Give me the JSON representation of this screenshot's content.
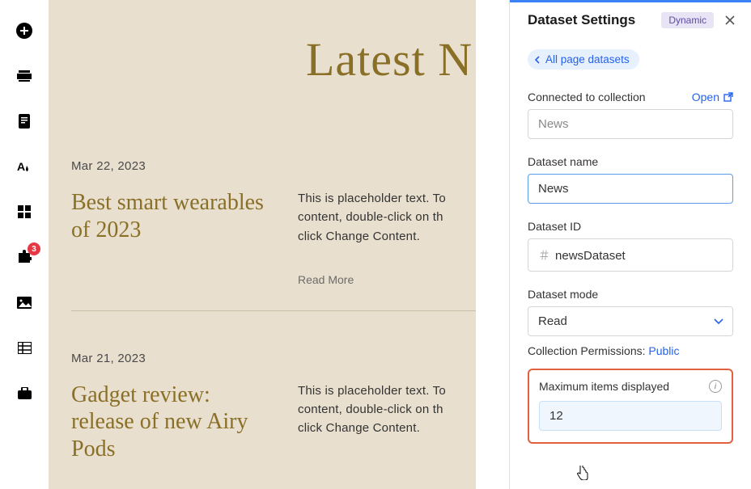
{
  "sidebar": {
    "badge_count": "3"
  },
  "canvas": {
    "heading": "Latest N",
    "articles": [
      {
        "date": "Mar 22, 2023",
        "title": "Best smart wearables of 2023",
        "text": "This is placeholder text. To content, double-click on th click Change Content.",
        "read_more": "Read More"
      },
      {
        "date": "Mar 21, 2023",
        "title": "Gadget review: release of new Airy Pods",
        "text": "This is placeholder text. To content, double-click on th click Change Content."
      }
    ]
  },
  "panel": {
    "title": "Dataset Settings",
    "chip": "Dynamic",
    "back_label": "All page datasets",
    "connected_label": "Connected to collection",
    "open_label": "Open",
    "collection_value": "News",
    "name_label": "Dataset name",
    "name_value": "News",
    "id_label": "Dataset ID",
    "id_value": "newsDataset",
    "mode_label": "Dataset mode",
    "mode_value": "Read",
    "permissions_label": "Collection Permissions:",
    "permissions_value": "Public",
    "max_label": "Maximum items displayed",
    "max_value": "12"
  }
}
